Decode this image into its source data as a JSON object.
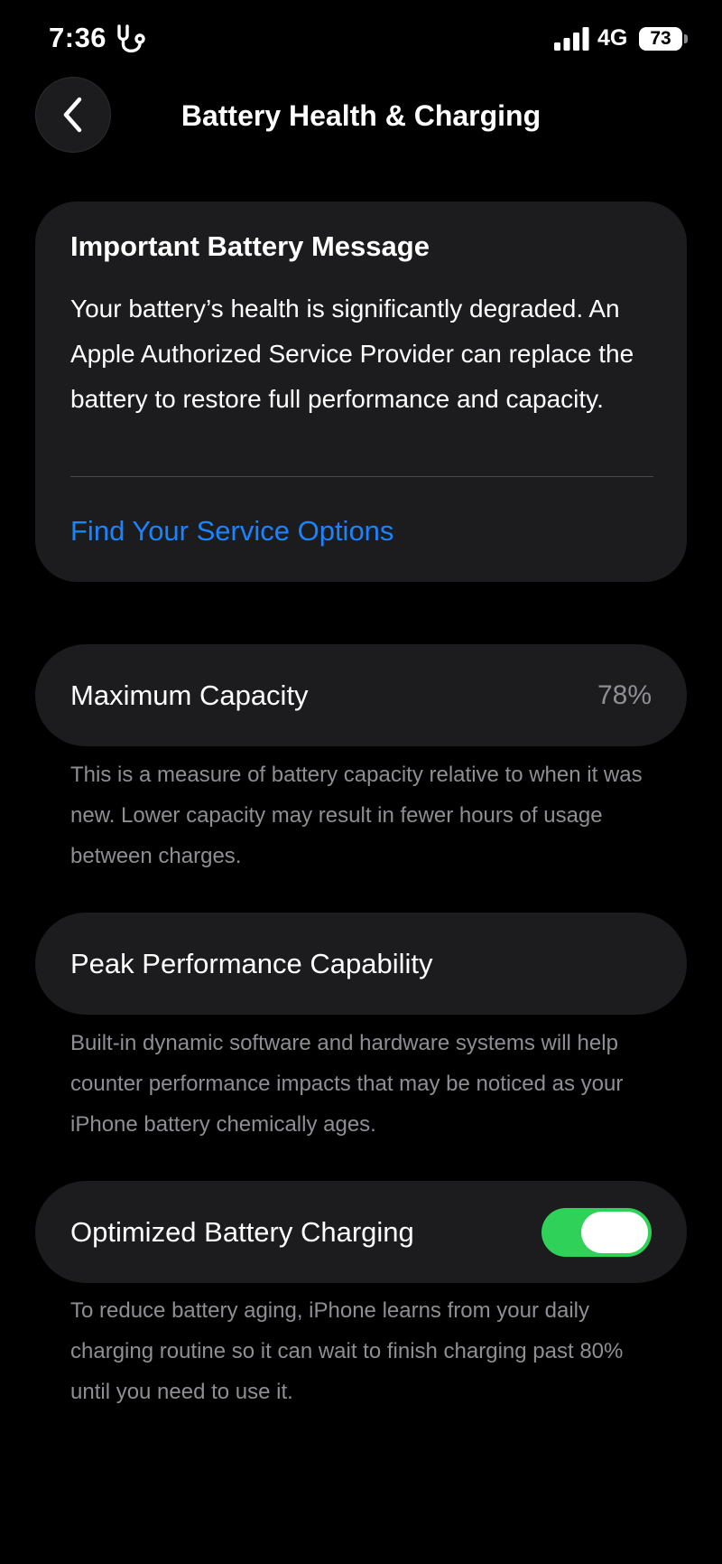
{
  "status_bar": {
    "time": "7:36",
    "activity_icon": "stethoscope-icon",
    "signal_icon": "cellular-signal-icon",
    "network": "4G",
    "battery_level": "73"
  },
  "nav": {
    "back_icon": "chevron-left-icon",
    "title": "Battery Health & Charging"
  },
  "message_card": {
    "title": "Important Battery Message",
    "body": "Your battery’s health is significantly degraded. An Apple Authorized Service Provider can replace the battery to restore full performance and capacity.",
    "link_label": "Find Your Service Options",
    "link_color": "#1a84ff"
  },
  "maximum_capacity": {
    "label": "Maximum Capacity",
    "value": "78%",
    "footnote": "This is a measure of battery capacity relative to when it was new. Lower capacity may result in fewer hours of usage between charges."
  },
  "peak_performance": {
    "label": "Peak Performance Capability",
    "footnote": "Built-in dynamic software and hardware systems will help counter performance impacts that may be noticed as your iPhone battery chemically ages."
  },
  "optimized_charging": {
    "label": "Optimized Battery Charging",
    "enabled": true,
    "toggle_color": "#30d158",
    "footnote": "To reduce battery aging, iPhone learns from your daily charging routine so it can wait to finish charging past 80% until you need to use it."
  }
}
